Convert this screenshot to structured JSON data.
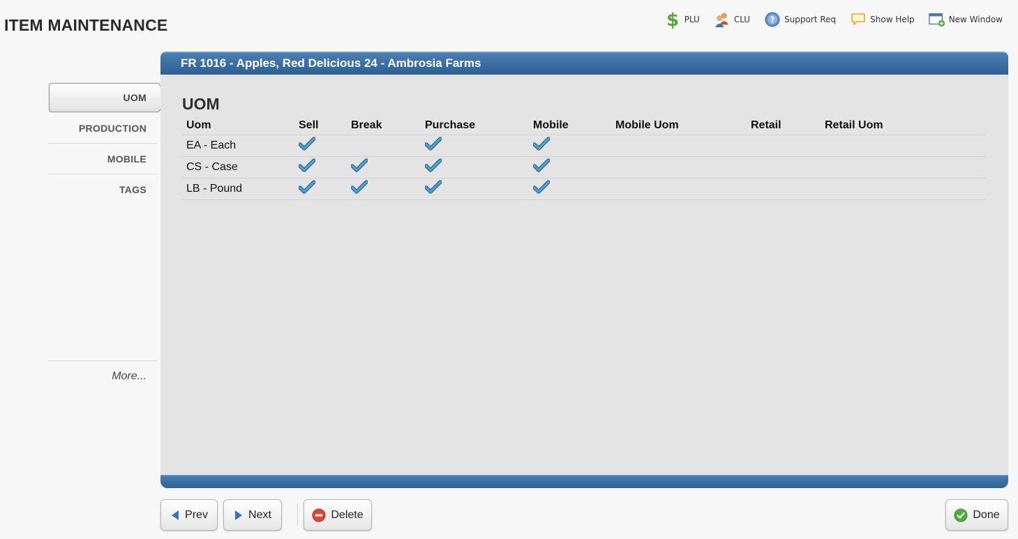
{
  "app": {
    "title": "ITEM MAINTENANCE"
  },
  "toolbar": [
    {
      "name": "plu",
      "label": "PLU",
      "icon": "dollar-icon"
    },
    {
      "name": "clu",
      "label": "CLU",
      "icon": "users-icon"
    },
    {
      "name": "support",
      "label": "Support Req",
      "icon": "help-circle-icon"
    },
    {
      "name": "help",
      "label": "Show Help",
      "icon": "speech-bubble-icon"
    },
    {
      "name": "newwindow",
      "label": "New Window",
      "icon": "new-window-icon"
    }
  ],
  "item": {
    "header": "FR 1016 - Apples, Red Delicious 24 - Ambrosia Farms"
  },
  "sidenav": {
    "active": "UOM",
    "items": [
      "PRODUCTION",
      "MOBILE",
      "TAGS"
    ],
    "more": "More..."
  },
  "uom": {
    "title": "UOM",
    "columns": [
      "Uom",
      "Sell",
      "Break",
      "Purchase",
      "Mobile",
      "Mobile Uom",
      "Retail",
      "Retail Uom"
    ],
    "rows": [
      {
        "uom": "EA - Each",
        "sell": true,
        "break": false,
        "purchase": true,
        "mobile": true,
        "mobile_uom": "",
        "retail": "",
        "retail_uom": ""
      },
      {
        "uom": "CS - Case",
        "sell": true,
        "break": true,
        "purchase": true,
        "mobile": true,
        "mobile_uom": "",
        "retail": "",
        "retail_uom": ""
      },
      {
        "uom": "LB - Pound",
        "sell": true,
        "break": true,
        "purchase": true,
        "mobile": true,
        "mobile_uom": "",
        "retail": "",
        "retail_uom": ""
      }
    ]
  },
  "buttons": {
    "prev": "Prev",
    "next": "Next",
    "delete": "Delete",
    "done": "Done"
  },
  "colors": {
    "header_blue": "#2d5f92",
    "check_blue": "#3a84b5",
    "panel_bg": "#e4e4e4"
  }
}
